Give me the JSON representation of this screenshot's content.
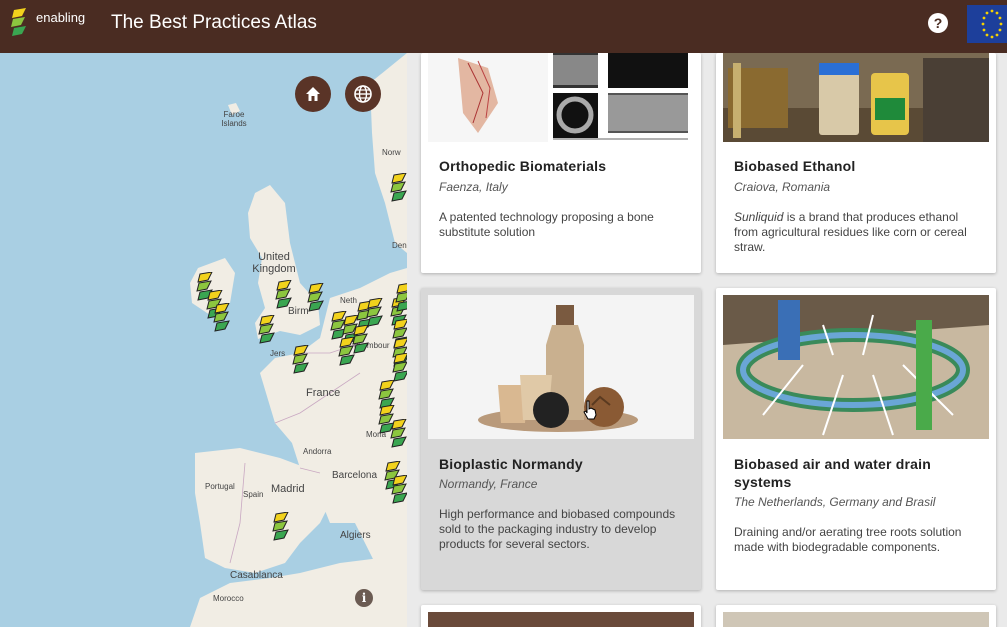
{
  "header": {
    "logo_text": "enabling",
    "title": "The Best Practices Atlas",
    "help_label": "?"
  },
  "map": {
    "info_label": "i",
    "labels": [
      "Faroe Islands",
      "United Kingdom",
      "Birm",
      "Norw",
      "Den",
      "Neth",
      "Jers",
      "uxembour",
      "France",
      "Mona",
      "Andorra",
      "Barcelona",
      "Portugal",
      "Spain",
      "Madrid",
      "Algiers",
      "Casablanca",
      "Morocco"
    ]
  },
  "cards": [
    {
      "title": "Orthopedic Biomaterials",
      "location": "Faenza, Italy",
      "description": "A patented technology proposing a bone substitute solution"
    },
    {
      "title": "Biobased Ethanol",
      "location": "Craiova, Romania",
      "description_em": "Sunliquid",
      "description": " is a brand that produces ethanol from agricultural residues like corn or cereal straw."
    },
    {
      "title": "Bioplastic Normandy",
      "location": "Normandy, France",
      "description": "High performance and biobased compounds sold to the packaging industry to develop products for several sectors."
    },
    {
      "title": "Biobased air and water drain systems",
      "location": "The Netherlands, Germany and Brasil",
      "description": "Draining and/or aerating tree roots solution made with biodegradable components."
    }
  ]
}
